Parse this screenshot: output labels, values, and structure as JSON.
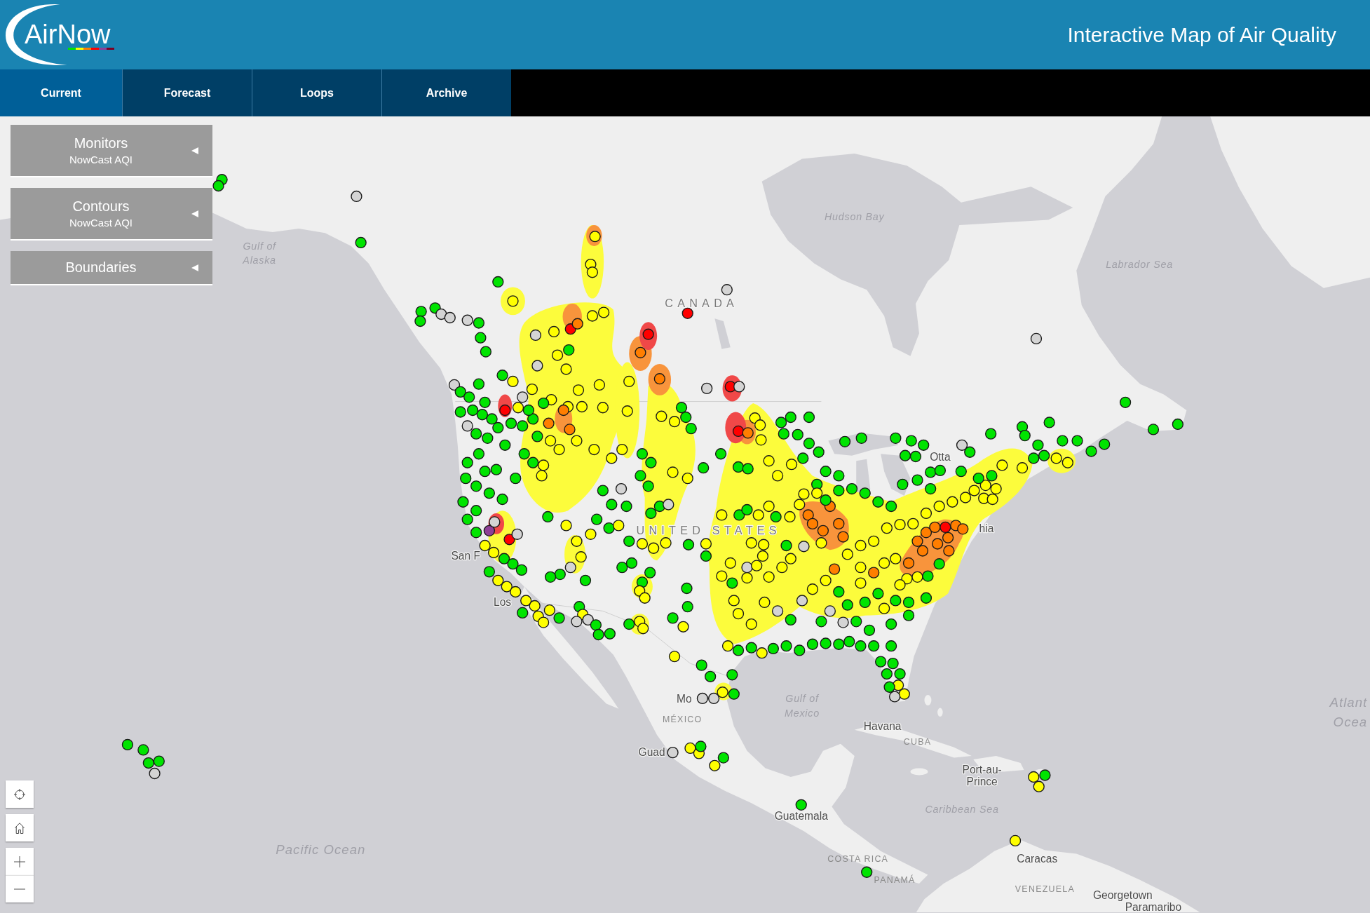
{
  "header": {
    "logo": "AirNow",
    "title": "Interactive Map of Air Quality"
  },
  "nav_tabs": [
    {
      "label": "Current",
      "selected": true
    },
    {
      "label": "Forecast",
      "selected": false
    },
    {
      "label": "Loops",
      "selected": false
    },
    {
      "label": "Archive",
      "selected": false
    }
  ],
  "layer_panels": [
    {
      "title": "Monitors",
      "subtitle": "NowCast AQI",
      "expanded": false
    },
    {
      "title": "Contours",
      "subtitle": "NowCast AQI",
      "expanded": false
    },
    {
      "title": "Boundaries",
      "expanded": false
    }
  ],
  "map": {
    "labels": [
      {
        "kind": "water",
        "lines": [
          "Gulf of",
          "Alaska"
        ]
      },
      {
        "kind": "water",
        "lines": [
          "Hudson Bay"
        ]
      },
      {
        "kind": "water",
        "lines": [
          "Labrador Sea"
        ]
      },
      {
        "kind": "nation",
        "lines": [
          "CANADA"
        ]
      },
      {
        "kind": "nation",
        "lines": [
          "UNITED STATES"
        ]
      },
      {
        "kind": "city",
        "lines": [
          "Otta"
        ]
      },
      {
        "kind": "city",
        "lines": [
          "San F"
        ]
      },
      {
        "kind": "city",
        "lines": [
          "Los"
        ]
      },
      {
        "kind": "city",
        "lines": [
          "hia"
        ]
      },
      {
        "kind": "city",
        "lines": [
          "Mo"
        ]
      },
      {
        "kind": "country",
        "lines": [
          "MÉXICO"
        ]
      },
      {
        "kind": "water",
        "lines": [
          "Gulf of",
          "Mexico"
        ]
      },
      {
        "kind": "city",
        "lines": [
          "Havana"
        ]
      },
      {
        "kind": "country",
        "lines": [
          "CUBA"
        ]
      },
      {
        "kind": "city",
        "lines": [
          "Port-au-",
          "Prince"
        ]
      },
      {
        "kind": "water",
        "lines": [
          "Caribbean Sea"
        ]
      },
      {
        "kind": "city",
        "lines": [
          "Guad"
        ]
      },
      {
        "kind": "city",
        "lines": [
          "Guatemala"
        ]
      },
      {
        "kind": "country",
        "lines": [
          "COSTA RICA"
        ]
      },
      {
        "kind": "country",
        "lines": [
          "PANAMÁ"
        ]
      },
      {
        "kind": "city",
        "lines": [
          "Caracas"
        ]
      },
      {
        "kind": "country",
        "lines": [
          "VENEZUELA"
        ]
      },
      {
        "kind": "city",
        "lines": [
          "Georgetown"
        ]
      },
      {
        "kind": "city",
        "lines": [
          "Paramaribo"
        ]
      },
      {
        "kind": "ocean",
        "lines": [
          "Atlant",
          "Ocea"
        ]
      },
      {
        "kind": "ocean",
        "lines": [
          "Pacific Ocean"
        ]
      }
    ],
    "contours": [
      {
        "color": "#fcfc3c"
      },
      {
        "color": "#fcfc3c"
      },
      {
        "color": "#fcfc3c"
      },
      {
        "color": "#fcfc3c"
      },
      {
        "color": "#fcfc3c"
      },
      {
        "color": "#fcfc3c"
      },
      {
        "color": "#fcfc3c"
      },
      {
        "color": "#fcfc3c"
      },
      {
        "color": "#fcfc3c"
      },
      {
        "color": "#fcfc3c"
      },
      {
        "color": "#fcfc3c"
      },
      {
        "color": "#fcfc3c"
      },
      {
        "color": "#f8943c"
      },
      {
        "color": "#f8943c"
      },
      {
        "color": "#f8943c"
      },
      {
        "color": "#f8943c"
      },
      {
        "color": "#f8943c"
      },
      {
        "color": "#f8943c"
      },
      {
        "color": "#f8943c"
      },
      {
        "color": "#f8943c"
      },
      {
        "color": "#f04848"
      },
      {
        "color": "#f04848"
      },
      {
        "color": "#f04848"
      },
      {
        "color": "#f04848"
      },
      {
        "color": "#f04848"
      }
    ],
    "monitors": [
      {
        "color": "#00e400"
      },
      {
        "color": "#00e400"
      },
      {
        "color": "#d4d4d4"
      },
      {
        "color": "#00e400"
      },
      {
        "color": "#00e400"
      },
      {
        "color": "#00e400"
      },
      {
        "color": "#00e400"
      },
      {
        "color": "#00e400"
      },
      {
        "color": "#d4d4d4"
      },
      {
        "color": "#d4d4d4"
      },
      {
        "color": "#d4d4d4"
      },
      {
        "color": "#00e400"
      },
      {
        "color": "#00e400"
      },
      {
        "color": "#00e400"
      },
      {
        "color": "#ffff00"
      },
      {
        "color": "#d4d4d4"
      },
      {
        "color": "#ffff00"
      },
      {
        "color": "#ff0000"
      },
      {
        "color": "#ff7e00"
      },
      {
        "color": "#ffff00"
      },
      {
        "color": "#ffff00"
      },
      {
        "color": "#ffff00"
      },
      {
        "color": "#ffff00"
      },
      {
        "color": "#ffff00"
      },
      {
        "color": "#d4d4d4"
      },
      {
        "color": "#ff0000"
      },
      {
        "color": "#d4d4d4"
      },
      {
        "color": "#00e400"
      },
      {
        "color": "#00e400"
      },
      {
        "color": "#00e400"
      },
      {
        "color": "#d4d4d4"
      },
      {
        "color": "#ffff00"
      },
      {
        "color": "#ffff00"
      },
      {
        "color": "#00e400"
      },
      {
        "color": "#ff0000"
      },
      {
        "color": "#ff7e00"
      },
      {
        "color": "#ff7e00"
      },
      {
        "color": "#ffff00"
      },
      {
        "color": "#ffff00"
      },
      {
        "color": "#ffff00"
      },
      {
        "color": "#d4d4d4"
      },
      {
        "color": "#ff0000"
      },
      {
        "color": "#d4d4d4"
      },
      {
        "color": "#ff0000"
      },
      {
        "color": "#ff7e00"
      },
      {
        "color": "#00e400"
      },
      {
        "color": "#ffff00"
      },
      {
        "color": "#ffff00"
      },
      {
        "color": "#ffff00"
      },
      {
        "color": "#ffff00"
      },
      {
        "color": "#ffff00"
      },
      {
        "color": "#ffff00"
      },
      {
        "color": "#ffff00"
      },
      {
        "color": "#ffff00"
      },
      {
        "color": "#ffff00"
      },
      {
        "color": "#ffff00"
      },
      {
        "color": "#00e400"
      },
      {
        "color": "#00e400"
      },
      {
        "color": "#00e400"
      },
      {
        "color": "#ffff00"
      },
      {
        "color": "#ffff00"
      },
      {
        "color": "#ffff00"
      },
      {
        "color": "#00e400"
      },
      {
        "color": "#00e400"
      },
      {
        "color": "#00e400"
      },
      {
        "color": "#00e400"
      },
      {
        "color": "#00e400"
      },
      {
        "color": "#00e400"
      },
      {
        "color": "#00e400"
      },
      {
        "color": "#00e400"
      },
      {
        "color": "#00e400"
      },
      {
        "color": "#00e400"
      },
      {
        "color": "#00e400"
      },
      {
        "color": "#00e400"
      },
      {
        "color": "#00e400"
      },
      {
        "color": "#00e400"
      },
      {
        "color": "#00e400"
      },
      {
        "color": "#00e400"
      },
      {
        "color": "#d4d4d4"
      },
      {
        "color": "#00e400"
      },
      {
        "color": "#00e400"
      },
      {
        "color": "#00e400"
      },
      {
        "color": "#00e400"
      },
      {
        "color": "#00e400"
      },
      {
        "color": "#00e400"
      },
      {
        "color": "#00e400"
      },
      {
        "color": "#00e400"
      },
      {
        "color": "#ffff00"
      },
      {
        "color": "#ffff00"
      },
      {
        "color": "#00e400"
      },
      {
        "color": "#00e400"
      },
      {
        "color": "#00e400"
      },
      {
        "color": "#00e400"
      },
      {
        "color": "#ffff00"
      },
      {
        "color": "#ffff00"
      },
      {
        "color": "#00e400"
      },
      {
        "color": "#d4d4d4"
      },
      {
        "color": "#00e400"
      },
      {
        "color": "#00e400"
      },
      {
        "color": "#00e400"
      },
      {
        "color": "#00e400"
      },
      {
        "color": "#00e400"
      },
      {
        "color": "#00e400"
      },
      {
        "color": "#00e400"
      },
      {
        "color": "#00e400"
      },
      {
        "color": "#d4d4d4"
      },
      {
        "color": "#00e400"
      },
      {
        "color": "#00e400"
      },
      {
        "color": "#00e400"
      },
      {
        "color": "#00e400"
      },
      {
        "color": "#00e400"
      },
      {
        "color": "#00e400"
      },
      {
        "color": "#00e400"
      },
      {
        "color": "#ff0000"
      },
      {
        "color": "#d4d4d4"
      },
      {
        "color": "#00e400"
      },
      {
        "color": "#00e400"
      },
      {
        "color": "#ff7e00"
      },
      {
        "color": "#ff7e00"
      },
      {
        "color": "#ff7e00"
      },
      {
        "color": "#00e400"
      },
      {
        "color": "#00e400"
      },
      {
        "color": "#00e400"
      },
      {
        "color": "#00e400"
      },
      {
        "color": "#00e400"
      },
      {
        "color": "#00e400"
      },
      {
        "color": "#00e400"
      },
      {
        "color": "#00e400"
      },
      {
        "color": "#00e400"
      },
      {
        "color": "#00e400"
      },
      {
        "color": "#00e400"
      },
      {
        "color": "#00e400"
      },
      {
        "color": "#00e400"
      },
      {
        "color": "#00e400"
      },
      {
        "color": "#ffff00"
      },
      {
        "color": "#ffff00"
      },
      {
        "color": "#ffff00"
      },
      {
        "color": "#ffff00"
      },
      {
        "color": "#ffff00"
      },
      {
        "color": "#ffff00"
      },
      {
        "color": "#ffff00"
      },
      {
        "color": "#ffff00"
      },
      {
        "color": "#00e400"
      },
      {
        "color": "#00e400"
      },
      {
        "color": "#00e400"
      },
      {
        "color": "#00e400"
      },
      {
        "color": "#ffff00"
      },
      {
        "color": "#ffff00"
      },
      {
        "color": "#00e400"
      },
      {
        "color": "#00e400"
      },
      {
        "color": "#00e400"
      },
      {
        "color": "#00e400"
      },
      {
        "color": "#ffff00"
      },
      {
        "color": "#ffff00"
      },
      {
        "color": "#ffff00"
      },
      {
        "color": "#00e400"
      },
      {
        "color": "#00e400"
      },
      {
        "color": "#00e400"
      },
      {
        "color": "#00e400"
      },
      {
        "color": "#00e400"
      },
      {
        "color": "#00e400"
      },
      {
        "color": "#8f3f97"
      },
      {
        "color": "#d4d4d4"
      },
      {
        "color": "#ff0000"
      },
      {
        "color": "#d4d4d4"
      },
      {
        "color": "#ffff00"
      },
      {
        "color": "#ffff00"
      },
      {
        "color": "#00e400"
      },
      {
        "color": "#00e400"
      },
      {
        "color": "#00e400"
      },
      {
        "color": "#00e400"
      },
      {
        "color": "#ffff00"
      },
      {
        "color": "#ffff00"
      },
      {
        "color": "#ffff00"
      },
      {
        "color": "#ffff00"
      },
      {
        "color": "#ffff00"
      },
      {
        "color": "#00e400"
      },
      {
        "color": "#ffff00"
      },
      {
        "color": "#ffff00"
      },
      {
        "color": "#00e400"
      },
      {
        "color": "#ffff00"
      },
      {
        "color": "#00e400"
      },
      {
        "color": "#ffff00"
      },
      {
        "color": "#ffff00"
      },
      {
        "color": "#ffff00"
      },
      {
        "color": "#d4d4d4"
      },
      {
        "color": "#00e400"
      },
      {
        "color": "#00e400"
      },
      {
        "color": "#00e400"
      },
      {
        "color": "#00e400"
      },
      {
        "color": "#ffff00"
      },
      {
        "color": "#d4d4d4"
      },
      {
        "color": "#00e400"
      },
      {
        "color": "#00e400"
      },
      {
        "color": "#00e400"
      },
      {
        "color": "#d4d4d4"
      },
      {
        "color": "#00e400"
      },
      {
        "color": "#00e400"
      },
      {
        "color": "#00e400"
      },
      {
        "color": "#d4d4d4"
      },
      {
        "color": "#00e400"
      },
      {
        "color": "#00e400"
      },
      {
        "color": "#ffff00"
      },
      {
        "color": "#ffff00"
      },
      {
        "color": "#00e400"
      },
      {
        "color": "#ffff00"
      },
      {
        "color": "#ffff00"
      },
      {
        "color": "#00e400"
      },
      {
        "color": "#00e400"
      },
      {
        "color": "#d4d4d4"
      },
      {
        "color": "#ffff00"
      },
      {
        "color": "#00e400"
      },
      {
        "color": "#00e400"
      },
      {
        "color": "#00e400"
      },
      {
        "color": "#00e400"
      },
      {
        "color": "#00e400"
      },
      {
        "color": "#ffff00"
      },
      {
        "color": "#ffff00"
      },
      {
        "color": "#00e400"
      },
      {
        "color": "#ffff00"
      },
      {
        "color": "#ffff00"
      },
      {
        "color": "#00e400"
      },
      {
        "color": "#ffff00"
      },
      {
        "color": "#00e400"
      },
      {
        "color": "#00e400"
      },
      {
        "color": "#ffff00"
      },
      {
        "color": "#00e400"
      },
      {
        "color": "#00e400"
      },
      {
        "color": "#00e400"
      },
      {
        "color": "#d4d4d4"
      },
      {
        "color": "#d4d4d4"
      },
      {
        "color": "#ffff00"
      },
      {
        "color": "#00e400"
      },
      {
        "color": "#ffff00"
      },
      {
        "color": "#00e400"
      },
      {
        "color": "#ffff00"
      },
      {
        "color": "#00e400"
      },
      {
        "color": "#00e400"
      },
      {
        "color": "#ffff00"
      },
      {
        "color": "#ffff00"
      },
      {
        "color": "#ffff00"
      },
      {
        "color": "#ffff00"
      },
      {
        "color": "#00e400"
      },
      {
        "color": "#ffff00"
      },
      {
        "color": "#ffff00"
      },
      {
        "color": "#ffff00"
      },
      {
        "color": "#ffff00"
      },
      {
        "color": "#ff7e00"
      },
      {
        "color": "#ff7e00"
      },
      {
        "color": "#ff7e00"
      },
      {
        "color": "#ff7e00"
      },
      {
        "color": "#ff7e00"
      },
      {
        "color": "#ff7e00"
      },
      {
        "color": "#ffff00"
      },
      {
        "color": "#d4d4d4"
      },
      {
        "color": "#00e400"
      },
      {
        "color": "#ffff00"
      },
      {
        "color": "#00e400"
      },
      {
        "color": "#d4d4d4"
      },
      {
        "color": "#ffff00"
      },
      {
        "color": "#ffff00"
      },
      {
        "color": "#ffff00"
      },
      {
        "color": "#ffff00"
      },
      {
        "color": "#ffff00"
      },
      {
        "color": "#ffff00"
      },
      {
        "color": "#ffff00"
      },
      {
        "color": "#ffff00"
      },
      {
        "color": "#ffff00"
      },
      {
        "color": "#ffff00"
      },
      {
        "color": "#ffff00"
      },
      {
        "color": "#d4d4d4"
      },
      {
        "color": "#00e400"
      },
      {
        "color": "#d4d4d4"
      },
      {
        "color": "#ffff00"
      },
      {
        "color": "#ffff00"
      },
      {
        "color": "#ff7e00"
      },
      {
        "color": "#ffff00"
      },
      {
        "color": "#ffff00"
      },
      {
        "color": "#ffff00"
      },
      {
        "color": "#ffff00"
      },
      {
        "color": "#ff7e00"
      },
      {
        "color": "#ffff00"
      },
      {
        "color": "#ffff00"
      },
      {
        "color": "#ff7e00"
      },
      {
        "color": "#ff7e00"
      },
      {
        "color": "#ff7e00"
      },
      {
        "color": "#ff7e00"
      },
      {
        "color": "#ff0000"
      },
      {
        "color": "#ff7e00"
      },
      {
        "color": "#ff7e00"
      },
      {
        "color": "#ff7e00"
      },
      {
        "color": "#ff7e00"
      },
      {
        "color": "#ff7e00"
      },
      {
        "color": "#ff7e00"
      },
      {
        "color": "#ffff00"
      },
      {
        "color": "#ffff00"
      },
      {
        "color": "#ffff00"
      },
      {
        "color": "#ffff00"
      },
      {
        "color": "#ffff00"
      },
      {
        "color": "#ffff00"
      },
      {
        "color": "#ffff00"
      },
      {
        "color": "#ffff00"
      },
      {
        "color": "#ffff00"
      },
      {
        "color": "#ffff00"
      },
      {
        "color": "#ffff00"
      },
      {
        "color": "#ffff00"
      },
      {
        "color": "#00e400"
      },
      {
        "color": "#00e400"
      },
      {
        "color": "#00e400"
      },
      {
        "color": "#00e400"
      },
      {
        "color": "#00e400"
      },
      {
        "color": "#00e400"
      },
      {
        "color": "#00e400"
      },
      {
        "color": "#00e400"
      },
      {
        "color": "#00e400"
      },
      {
        "color": "#00e400"
      },
      {
        "color": "#00e400"
      },
      {
        "color": "#ffff00"
      },
      {
        "color": "#ffff00"
      },
      {
        "color": "#00e400"
      },
      {
        "color": "#00e400"
      },
      {
        "color": "#00e400"
      },
      {
        "color": "#00e400"
      },
      {
        "color": "#00e400"
      },
      {
        "color": "#00e400"
      },
      {
        "color": "#00e400"
      },
      {
        "color": "#00e400"
      },
      {
        "color": "#00e400"
      },
      {
        "color": "#d4d4d4"
      },
      {
        "color": "#00e400"
      },
      {
        "color": "#d4d4d4"
      },
      {
        "color": "#00e400"
      },
      {
        "color": "#00e400"
      },
      {
        "color": "#00e400"
      },
      {
        "color": "#00e400"
      },
      {
        "color": "#ffff00"
      },
      {
        "color": "#ffff00"
      },
      {
        "color": "#ffff00"
      },
      {
        "color": "#ffff00"
      },
      {
        "color": "#00e400"
      },
      {
        "color": "#00e400"
      },
      {
        "color": "#ffff00"
      },
      {
        "color": "#00e400"
      },
      {
        "color": "#00e400"
      },
      {
        "color": "#00e400"
      },
      {
        "color": "#00e400"
      },
      {
        "color": "#00e400"
      },
      {
        "color": "#00e400"
      },
      {
        "color": "#00e400"
      },
      {
        "color": "#00e400"
      },
      {
        "color": "#00e400"
      },
      {
        "color": "#00e400"
      },
      {
        "color": "#00e400"
      },
      {
        "color": "#00e400"
      },
      {
        "color": "#00e400"
      },
      {
        "color": "#00e400"
      },
      {
        "color": "#ffff00"
      },
      {
        "color": "#ffff00"
      },
      {
        "color": "#d4d4d4"
      },
      {
        "color": "#00e400"
      },
      {
        "color": "#d4d4d4"
      },
      {
        "color": "#ffff00"
      },
      {
        "color": "#ffff00"
      },
      {
        "color": "#00e400"
      },
      {
        "color": "#ffff00"
      },
      {
        "color": "#00e400"
      },
      {
        "color": "#00e400"
      },
      {
        "color": "#00e400"
      },
      {
        "color": "#ffff00"
      },
      {
        "color": "#ffff00"
      },
      {
        "color": "#00e400"
      },
      {
        "color": "#ffff00"
      },
      {
        "color": "#00e400"
      },
      {
        "color": "#00e400"
      },
      {
        "color": "#00e400"
      },
      {
        "color": "#00e400"
      },
      {
        "color": "#d4d4d4"
      }
    ]
  }
}
